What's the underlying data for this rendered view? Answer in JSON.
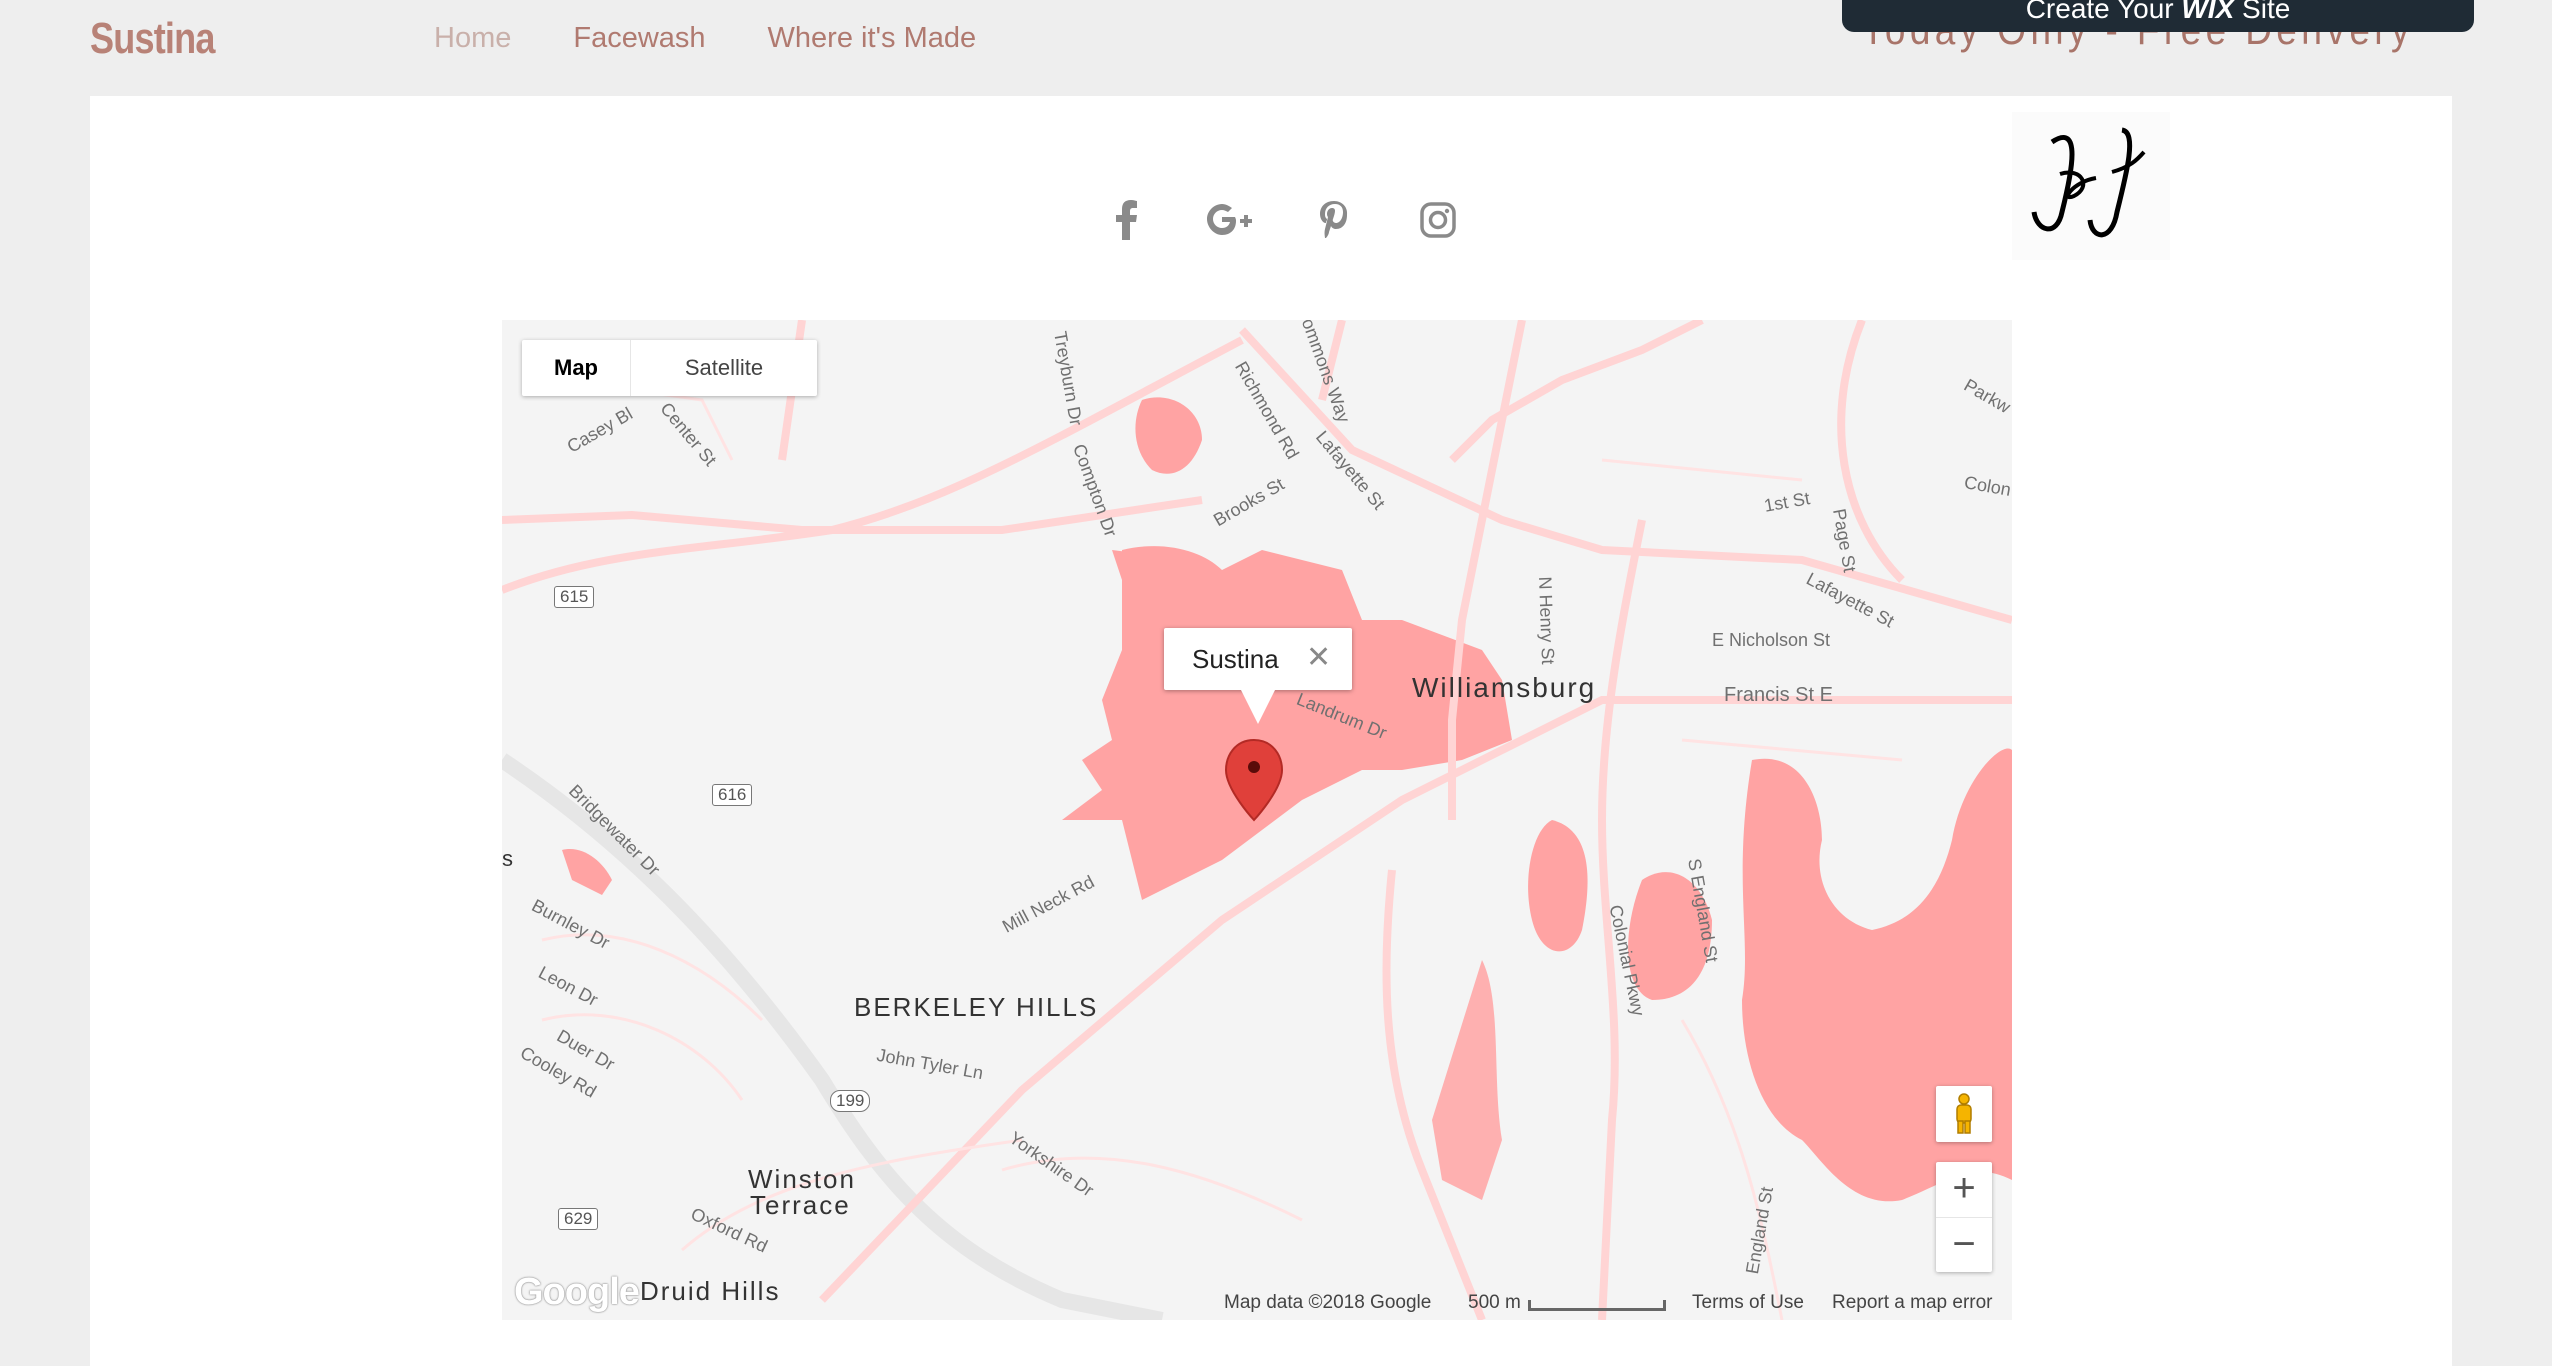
{
  "header": {
    "brand": "Sustina",
    "nav": [
      {
        "label": "Home",
        "active": true
      },
      {
        "label": "Facewash",
        "active": false
      },
      {
        "label": "Where it's Made",
        "active": false
      }
    ],
    "promo": "Today Only - Free Delivery",
    "wix_banner": {
      "pre": "Create Your ",
      "brand": "WIX",
      "post": " Site"
    }
  },
  "social": [
    "facebook-icon",
    "google-plus-icon",
    "pinterest-icon",
    "instagram-icon"
  ],
  "map": {
    "type_controls": {
      "map": "Map",
      "satellite": "Satellite",
      "selected": "Map"
    },
    "info_window": {
      "title": "Sustina",
      "close": "✕"
    },
    "places": {
      "williamsburg": "Williamsburg",
      "berkeley_hills": "BERKELEY HILLS",
      "winston_terrace_1": "Winston",
      "winston_terrace_2": "Terrace",
      "druid_hills": "Druid Hills"
    },
    "roads": {
      "casey": "Casey Bl",
      "center": "Center St",
      "treyburn": "Treyburn Dr",
      "commons": "Commons Way",
      "richmond": "Richmond Rd",
      "lafayette1": "Lafayette St",
      "compton": "Compton Dr",
      "brooks": "Brooks St",
      "first": "1st St",
      "page": "Page St",
      "colonial": "Colon",
      "parkw": "Parkw",
      "lafayette2": "Lafayette St",
      "enicholson": "E Nicholson St",
      "francis": "Francis St E",
      "nhenry": "N Henry St",
      "landrum": "Landrum Dr",
      "bridgewater": "Bridgewater Dr",
      "burnley": "Burnley Dr",
      "leon": "Leon Dr",
      "duer": "Duer Dr",
      "cooley": "Cooley Rd",
      "millneck": "Mill Neck Rd",
      "johntyler": "John Tyler Ln",
      "yorkshire": "Yorkshire Dr",
      "oxford": "Oxford Rd",
      "colonialpkwy": "Colonial Pkwy",
      "sengland": "S England St",
      "england": "England St",
      "s": "s"
    },
    "shields": {
      "r615": "615",
      "r616": "616",
      "r199": "199",
      "r629": "629"
    },
    "zoom": {
      "in": "+",
      "out": "−"
    },
    "attribution": {
      "google": "Google",
      "data": "Map data ©2018 Google",
      "scale": "500 m",
      "terms": "Terms of Use",
      "report": "Report a map error"
    },
    "colors": {
      "land": "#f4f4f4",
      "area": "#ffa3a3",
      "road": "#ffd4d4",
      "marker": "#e0403a"
    }
  }
}
